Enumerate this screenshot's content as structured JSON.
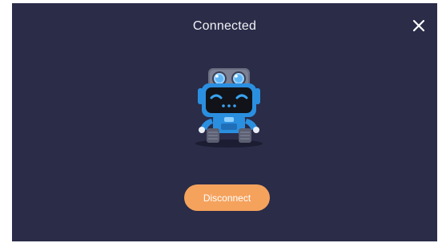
{
  "dialog": {
    "title": "Connected",
    "close_icon": "close-icon",
    "illustration": "robot-icon",
    "disconnect_label": "Disconnect"
  },
  "colors": {
    "background": "#2a2c48",
    "button": "#f5a25d",
    "robot_blue": "#2b8fe0",
    "text": "#f1f2f6"
  }
}
